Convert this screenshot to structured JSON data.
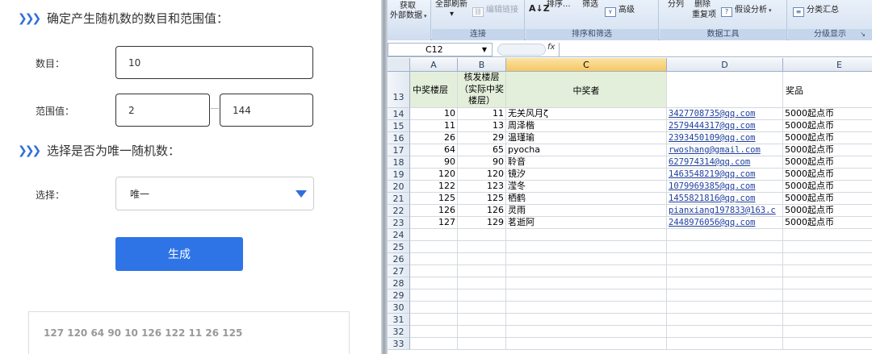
{
  "form": {
    "section1_title": "确定产生随机数的数目和范围值：",
    "count_label": "数目：",
    "count_value": "10",
    "range_label": "范围值：",
    "range_min": "2",
    "range_max": "144",
    "section2_title": "选择是否为唯一随机数：",
    "choice_label": "选择：",
    "choice_value": "唯一",
    "generate_label": "生成",
    "result": "127 120 64 90 10 126 122 11 26 125",
    "accent_color": "#2e74e6"
  },
  "excel": {
    "ribbon": {
      "get_external": [
        "获取",
        "外部数据"
      ],
      "refresh_all": "全部刷新",
      "edit_links": "编辑链接",
      "sort": "排序...",
      "filter": "筛选",
      "advanced": "高级",
      "split": "分列",
      "remove_dup": [
        "删除",
        "重复项"
      ],
      "whatif": "假设分析",
      "subtotal": "分类汇总",
      "groups": [
        "连接",
        "排序和筛选",
        "数据工具",
        "分级显示"
      ]
    },
    "name_box": "C12",
    "fx": "fx",
    "columns": [
      "A",
      "B",
      "C",
      "D",
      "E"
    ],
    "header_row": {
      "row": "13",
      "a": "中奖楼层",
      "b": "核发楼层（实际中奖楼层）",
      "c": "中奖者",
      "d": "",
      "e": "奖品"
    },
    "rows": [
      {
        "row": "14",
        "a": "10",
        "b": "11",
        "c": "无关风月ζ",
        "d": "3427708735@qq.com",
        "e": "5000起点币"
      },
      {
        "row": "15",
        "a": "11",
        "b": "13",
        "c": "周泽楷",
        "d": "2579444317@qq.com",
        "e": "5000起点币"
      },
      {
        "row": "16",
        "a": "26",
        "b": "29",
        "c": "温瑾瑜",
        "d": "2393450109@qq.com",
        "e": "5000起点币"
      },
      {
        "row": "17",
        "a": "64",
        "b": "65",
        "c": "pyocha",
        "d": "rwoshang@gmail.com",
        "e": "5000起点币"
      },
      {
        "row": "18",
        "a": "90",
        "b": "90",
        "c": "聆音",
        "d": "627974314@qq.com",
        "e": "5000起点币"
      },
      {
        "row": "19",
        "a": "120",
        "b": "120",
        "c": "镜汐",
        "d": "1463548219@qq.com",
        "e": "5000起点币"
      },
      {
        "row": "20",
        "a": "122",
        "b": "123",
        "c": "滢冬",
        "d": "1079969385@qq.com",
        "e": "5000起点币"
      },
      {
        "row": "21",
        "a": "125",
        "b": "125",
        "c": "栖鹤",
        "d": "1455821816@qq.com",
        "e": "5000起点币"
      },
      {
        "row": "22",
        "a": "126",
        "b": "126",
        "c": "灵雨",
        "d": "pianxiang197833@163.c",
        "e": "5000起点币"
      },
      {
        "row": "23",
        "a": "127",
        "b": "129",
        "c": "茗逝阿",
        "d": "2448976056@qq.com",
        "e": "5000起点币"
      }
    ],
    "empty_rows": [
      "24",
      "25",
      "26",
      "27",
      "28",
      "29",
      "30",
      "31",
      "32",
      "33"
    ]
  }
}
